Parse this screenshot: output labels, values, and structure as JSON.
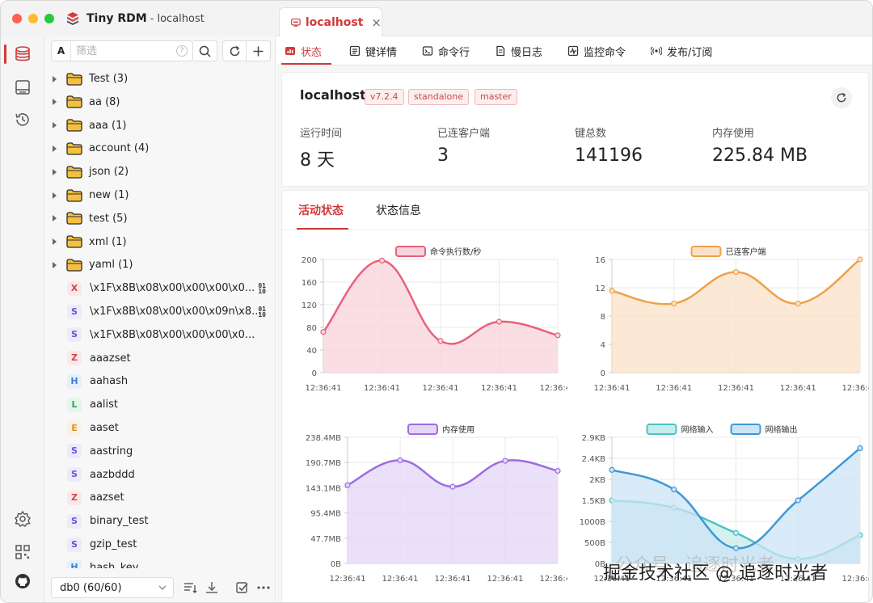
{
  "window": {
    "app_title": "Tiny RDM",
    "subtitle": "- localhost",
    "traffic_colors": [
      "#ff5f57",
      "#febc2e",
      "#28c840"
    ]
  },
  "connection_tab": {
    "label": "localhost",
    "close": "×"
  },
  "sidebar": {
    "filter_type": "A",
    "filter_placeholder": "筛选",
    "help": "?",
    "folders": [
      {
        "label": "Test (3)"
      },
      {
        "label": "aa (8)"
      },
      {
        "label": "aaa (1)"
      },
      {
        "label": "account (4)"
      },
      {
        "label": "json (2)"
      },
      {
        "label": "new (1)"
      },
      {
        "label": "test (5)"
      },
      {
        "label": "xml (1)"
      },
      {
        "label": "yaml (1)"
      }
    ],
    "keys": [
      {
        "type": "X",
        "label": "\\x1F\\x8B\\x08\\x00\\x00\\x00\\x0...",
        "binary": true
      },
      {
        "type": "S",
        "label": "\\x1F\\x8B\\x08\\x00\\x00\\x09n\\x8...",
        "binary": true
      },
      {
        "type": "S",
        "label": "\\x1F\\x8B\\x08\\x00\\x00\\x00\\x0...",
        "binary": false
      },
      {
        "type": "Z",
        "label": "aaazset",
        "binary": false
      },
      {
        "type": "H",
        "label": "aahash",
        "binary": false
      },
      {
        "type": "L",
        "label": "aalist",
        "binary": false
      },
      {
        "type": "E",
        "label": "aaset",
        "binary": false
      },
      {
        "type": "S",
        "label": "aastring",
        "binary": false
      },
      {
        "type": "S",
        "label": "aazbddd",
        "binary": false
      },
      {
        "type": "Z",
        "label": "aazset",
        "binary": false
      },
      {
        "type": "S",
        "label": "binary_test",
        "binary": false
      },
      {
        "type": "S",
        "label": "gzip_test",
        "binary": false
      },
      {
        "type": "H",
        "label": "hash_key",
        "binary": false
      }
    ],
    "binary_mark_top": "01",
    "binary_mark_bottom": "10",
    "db_select": "db0 (60/60)",
    "type_colors": {
      "X": {
        "fg": "#d64545",
        "bg": "#fbe9e9"
      },
      "S": {
        "fg": "#6a55d0",
        "bg": "#ecebfa"
      },
      "Z": {
        "fg": "#d64545",
        "bg": "#fbe9e9"
      },
      "H": {
        "fg": "#3b7fd6",
        "bg": "#e6f0fb"
      },
      "L": {
        "fg": "#2fa05a",
        "bg": "#e5f5ea"
      },
      "E": {
        "fg": "#e0932b",
        "bg": "#fcf1e1"
      }
    }
  },
  "subtabs": [
    {
      "label": "状态",
      "active": true
    },
    {
      "label": "键详情",
      "active": false
    },
    {
      "label": "命令行",
      "active": false
    },
    {
      "label": "慢日志",
      "active": false
    },
    {
      "label": "监控命令",
      "active": false
    },
    {
      "label": "发布/订阅",
      "active": false
    }
  ],
  "server": {
    "name": "localhost",
    "tags": [
      "v7.2.4",
      "standalone",
      "master"
    ],
    "stats": [
      {
        "label": "运行时间",
        "value": "8 天"
      },
      {
        "label": "已连客户端",
        "value": "3"
      },
      {
        "label": "键总数",
        "value": "141196"
      },
      {
        "label": "内存使用",
        "value": "225.84 MB"
      }
    ]
  },
  "activity": {
    "tabs": [
      {
        "label": "活动状态",
        "active": true
      },
      {
        "label": "状态信息",
        "active": false
      }
    ]
  },
  "watermark": {
    "gray_text": "公众号 · 追逐时光者",
    "text": "掘金技术社区 @ 追逐时光者"
  },
  "chart_data": [
    {
      "type": "area",
      "series": [
        {
          "name": "命令执行数/秒",
          "values": [
            72,
            198,
            56,
            90,
            66
          ],
          "color": "#e8617a",
          "fill": "#f9d3db"
        }
      ],
      "x": [
        "12:36:41",
        "12:36:41",
        "12:36:41",
        "12:36:41",
        "12:36:41"
      ],
      "yticks": [
        "0",
        "40",
        "80",
        "120",
        "160",
        "200"
      ],
      "ylim": [
        0,
        200
      ],
      "grid": true,
      "legend": "top-center"
    },
    {
      "type": "area",
      "series": [
        {
          "name": "已连客户端",
          "values": [
            13,
            11,
            16,
            11,
            18
          ],
          "color": "#eea24a",
          "fill": "#fbe2c7"
        }
      ],
      "x": [
        "12:36:41",
        "12:36:41",
        "12:36:41",
        "12:36:41",
        "12:36:41"
      ],
      "yticks": [
        "0",
        "4",
        "8",
        "12",
        "16"
      ],
      "ylim": [
        0,
        18
      ],
      "grid": true,
      "legend": "top-center"
    },
    {
      "type": "area",
      "series": [
        {
          "name": "内存使用",
          "values": [
            148,
            195,
            145,
            194,
            175
          ],
          "color": "#9d6de0",
          "fill": "#e4d6f7"
        }
      ],
      "x": [
        "12:36:41",
        "12:36:41",
        "12:36:41",
        "12:36:41",
        "12:36:41"
      ],
      "yticks": [
        "0B",
        "47.7MB",
        "95.4MB",
        "143.1MB",
        "190.7MB",
        "238.4MB"
      ],
      "ylim": [
        0,
        238.4
      ],
      "grid": true,
      "legend": "top-center"
    },
    {
      "type": "area",
      "series": [
        {
          "name": "网络输入",
          "values": [
            1.45,
            1.28,
            0.7,
            0.1,
            0.65
          ],
          "color": "#4cc3c3",
          "fill": "#c8ebeb"
        },
        {
          "name": "网络输出",
          "values": [
            2.15,
            1.7,
            0.35,
            1.45,
            2.65
          ],
          "color": "#3d98d8",
          "fill": "#cce4f5"
        }
      ],
      "x": [
        "12:36:41",
        "12:36:41",
        "12:36:41",
        "12:36:41",
        "12:36:41"
      ],
      "yticks": [
        "0B",
        "500B",
        "1000B",
        "1.5KB",
        "2KB",
        "2.4KB",
        "2.9KB"
      ],
      "ylim": [
        0,
        2.9
      ],
      "grid": true,
      "legend": "top-center"
    }
  ]
}
